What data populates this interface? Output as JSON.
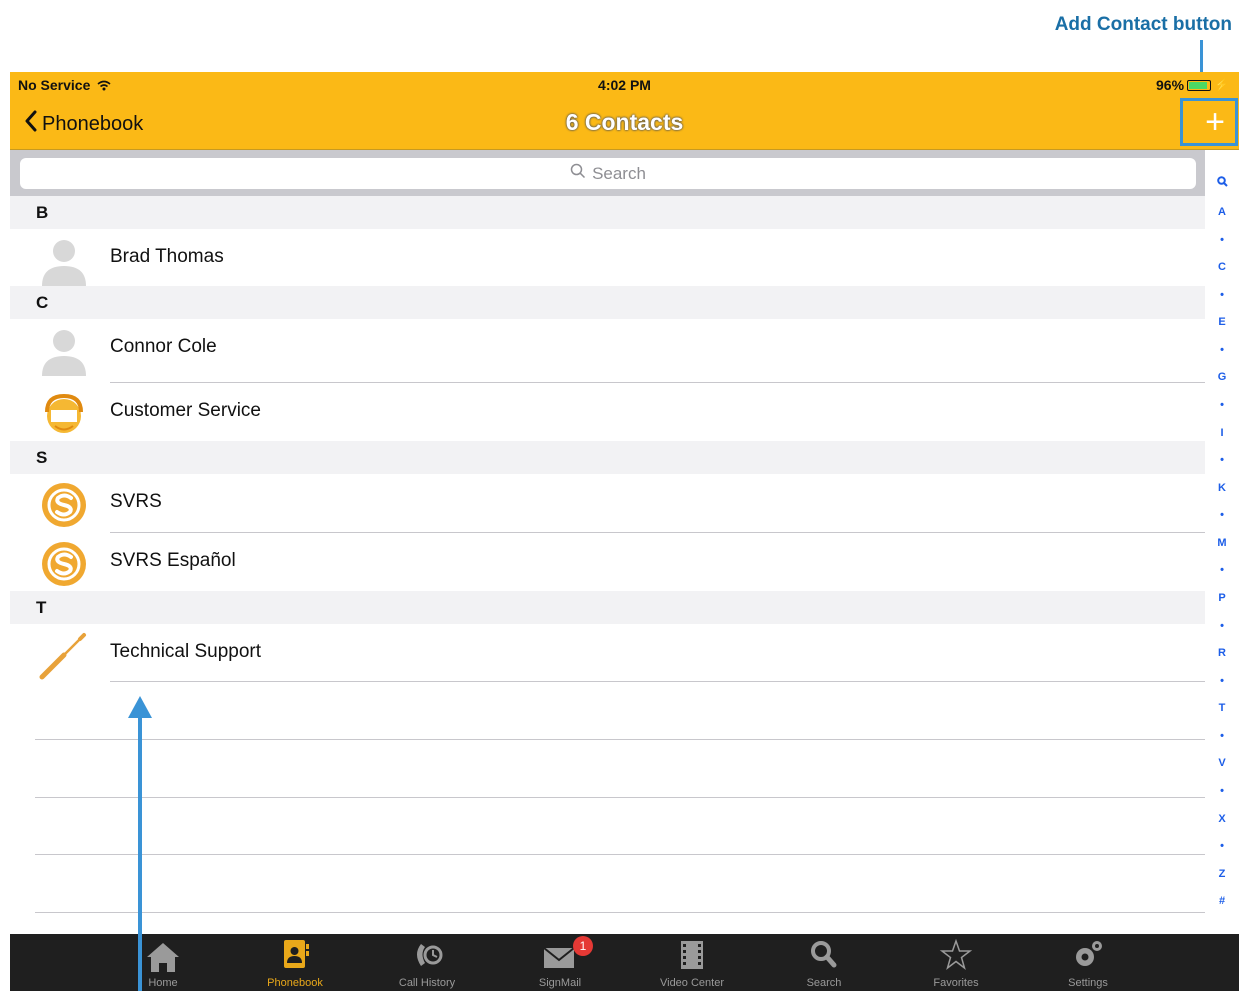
{
  "annotation": {
    "add_contact_label": "Add Contact button"
  },
  "status_bar": {
    "carrier": "No Service",
    "time": "4:02 PM",
    "battery": "96%"
  },
  "nav": {
    "back_label": "Phonebook",
    "title": "6 Contacts",
    "add_symbol": "+"
  },
  "search": {
    "placeholder": "Search"
  },
  "sections": [
    {
      "letter": "B",
      "contacts": [
        {
          "name": "Brad Thomas",
          "avatar": "person-placeholder-icon"
        }
      ]
    },
    {
      "letter": "C",
      "contacts": [
        {
          "name": "Connor Cole",
          "avatar": "person-placeholder-icon"
        },
        {
          "name": "Customer Service",
          "avatar": "customer-service-icon"
        }
      ]
    },
    {
      "letter": "S",
      "contacts": [
        {
          "name": "SVRS",
          "avatar": "svrs-logo-icon"
        },
        {
          "name": "SVRS Español",
          "avatar": "svrs-logo-icon"
        }
      ]
    },
    {
      "letter": "T",
      "contacts": [
        {
          "name": "Technical Support",
          "avatar": "screwdriver-icon"
        }
      ]
    }
  ],
  "index_letters": [
    "🔍",
    "A",
    "•",
    "C",
    "•",
    "E",
    "•",
    "G",
    "•",
    "I",
    "•",
    "K",
    "•",
    "M",
    "•",
    "P",
    "•",
    "R",
    "•",
    "T",
    "•",
    "V",
    "•",
    "X",
    "•",
    "Z",
    "#"
  ],
  "tabs": [
    {
      "label": "Home",
      "icon": "home-icon",
      "active": false
    },
    {
      "label": "Phonebook",
      "icon": "phonebook-icon",
      "active": true
    },
    {
      "label": "Call History",
      "icon": "call-history-icon",
      "active": false
    },
    {
      "label": "SignMail",
      "icon": "signmail-icon",
      "active": false,
      "badge": "1"
    },
    {
      "label": "Video Center",
      "icon": "video-center-icon",
      "active": false
    },
    {
      "label": "Search",
      "icon": "search-icon",
      "active": false
    },
    {
      "label": "Favorites",
      "icon": "star-icon",
      "active": false
    },
    {
      "label": "Settings",
      "icon": "gear-icon",
      "active": false
    }
  ],
  "colors": {
    "accent": "#fbb916",
    "index_blue": "#1d5ee8",
    "tab_active": "#e9a81a",
    "callout": "#3a93d6"
  }
}
